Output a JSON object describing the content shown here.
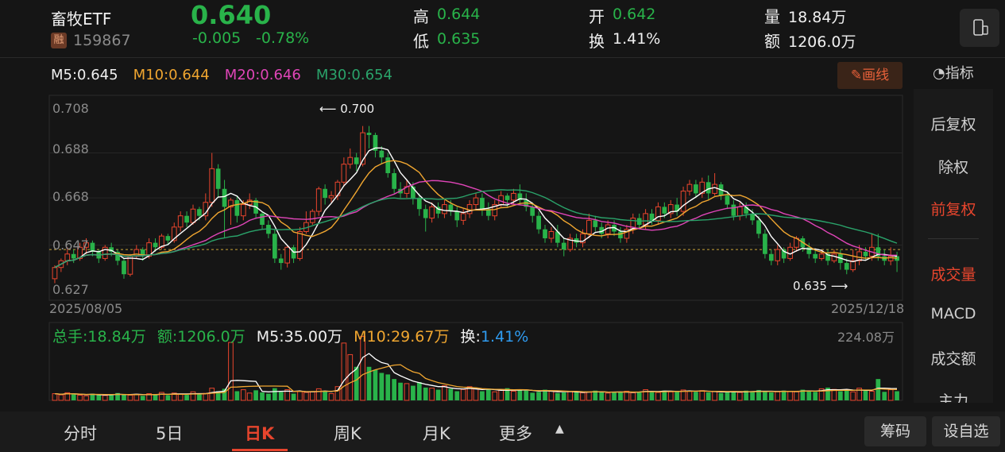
{
  "header": {
    "name": "畜牧ETF",
    "margin_badge": "融",
    "code": "159867",
    "price": "0.640",
    "change": "-0.005",
    "change_pct": "-0.78%",
    "high_label": "高",
    "high_value": "0.644",
    "low_label": "低",
    "low_value": "0.635",
    "open_label": "开",
    "open_value": "0.642",
    "turnover_label": "换",
    "turnover_value": "1.41%",
    "volume_label": "量",
    "volume_value": "18.84万",
    "amount_label": "额",
    "amount_value": "1206.0万"
  },
  "ma_legend": {
    "m5": "M5:0.645",
    "m10": "M10:0.644",
    "m20": "M20:0.646",
    "m30": "M30:0.654"
  },
  "draw_button": "画线",
  "indicator_label": "指标",
  "colors": {
    "up": "#e8452d",
    "down": "#29b34a",
    "ma5": "#ffffff",
    "ma10": "#f0a630",
    "ma20": "#e045b8",
    "ma30": "#2aa36a"
  },
  "chart_data": {
    "type": "candlestick",
    "y_ticks": [
      "0.708",
      "0.688",
      "0.668",
      "0.647",
      "0.627"
    ],
    "ylim": [
      0.627,
      0.708
    ],
    "x_start": "2025/08/05",
    "x_end": "2025/12/18",
    "annotation_high": "0.700",
    "annotation_low": "0.635",
    "reference_price": 0.645,
    "candles": [
      [
        0.632,
        0.637,
        0.63,
        0.638
      ],
      [
        0.637,
        0.64,
        0.635,
        0.641
      ],
      [
        0.64,
        0.643,
        0.638,
        0.646
      ],
      [
        0.643,
        0.641,
        0.639,
        0.645
      ],
      [
        0.641,
        0.646,
        0.64,
        0.648
      ],
      [
        0.646,
        0.648,
        0.643,
        0.65
      ],
      [
        0.648,
        0.644,
        0.642,
        0.649
      ],
      [
        0.644,
        0.641,
        0.639,
        0.645
      ],
      [
        0.641,
        0.646,
        0.64,
        0.647
      ],
      [
        0.646,
        0.644,
        0.642,
        0.648
      ],
      [
        0.644,
        0.64,
        0.638,
        0.645
      ],
      [
        0.64,
        0.634,
        0.632,
        0.641
      ],
      [
        0.634,
        0.642,
        0.633,
        0.643
      ],
      [
        0.642,
        0.645,
        0.641,
        0.647
      ],
      [
        0.645,
        0.642,
        0.64,
        0.646
      ],
      [
        0.642,
        0.648,
        0.641,
        0.65
      ],
      [
        0.648,
        0.646,
        0.644,
        0.65
      ],
      [
        0.646,
        0.651,
        0.645,
        0.652
      ],
      [
        0.651,
        0.649,
        0.647,
        0.652
      ],
      [
        0.649,
        0.655,
        0.648,
        0.657
      ],
      [
        0.655,
        0.66,
        0.653,
        0.662
      ],
      [
        0.66,
        0.657,
        0.655,
        0.662
      ],
      [
        0.657,
        0.663,
        0.656,
        0.665
      ],
      [
        0.663,
        0.66,
        0.658,
        0.664
      ],
      [
        0.66,
        0.666,
        0.658,
        0.67
      ],
      [
        0.666,
        0.681,
        0.664,
        0.688
      ],
      [
        0.681,
        0.672,
        0.668,
        0.683
      ],
      [
        0.672,
        0.664,
        0.65,
        0.676
      ],
      [
        0.664,
        0.667,
        0.656,
        0.668
      ],
      [
        0.667,
        0.66,
        0.657,
        0.669
      ],
      [
        0.66,
        0.665,
        0.658,
        0.667
      ],
      [
        0.665,
        0.667,
        0.663,
        0.67
      ],
      [
        0.667,
        0.661,
        0.659,
        0.668
      ],
      [
        0.661,
        0.656,
        0.654,
        0.662
      ],
      [
        0.656,
        0.652,
        0.65,
        0.658
      ],
      [
        0.652,
        0.641,
        0.639,
        0.654
      ],
      [
        0.641,
        0.639,
        0.636,
        0.643
      ],
      [
        0.639,
        0.646,
        0.637,
        0.647
      ],
      [
        0.646,
        0.641,
        0.639,
        0.647
      ],
      [
        0.641,
        0.653,
        0.64,
        0.655
      ],
      [
        0.653,
        0.657,
        0.652,
        0.662
      ],
      [
        0.657,
        0.662,
        0.656,
        0.663
      ],
      [
        0.662,
        0.672,
        0.66,
        0.673
      ],
      [
        0.672,
        0.668,
        0.665,
        0.674
      ],
      [
        0.668,
        0.669,
        0.666,
        0.671
      ],
      [
        0.669,
        0.675,
        0.667,
        0.676
      ],
      [
        0.675,
        0.683,
        0.673,
        0.686
      ],
      [
        0.683,
        0.686,
        0.681,
        0.69
      ],
      [
        0.686,
        0.683,
        0.68,
        0.688
      ],
      [
        0.683,
        0.697,
        0.682,
        0.7
      ],
      [
        0.697,
        0.696,
        0.69,
        0.7
      ],
      [
        0.696,
        0.689,
        0.686,
        0.697
      ],
      [
        0.689,
        0.686,
        0.683,
        0.691
      ],
      [
        0.686,
        0.679,
        0.677,
        0.688
      ],
      [
        0.679,
        0.672,
        0.67,
        0.681
      ],
      [
        0.672,
        0.67,
        0.668,
        0.675
      ],
      [
        0.67,
        0.673,
        0.668,
        0.676
      ],
      [
        0.673,
        0.668,
        0.665,
        0.675
      ],
      [
        0.668,
        0.663,
        0.66,
        0.67
      ],
      [
        0.663,
        0.659,
        0.653,
        0.665
      ],
      [
        0.659,
        0.664,
        0.657,
        0.666
      ],
      [
        0.664,
        0.661,
        0.659,
        0.666
      ],
      [
        0.661,
        0.665,
        0.659,
        0.667
      ],
      [
        0.665,
        0.662,
        0.66,
        0.667
      ],
      [
        0.662,
        0.658,
        0.655,
        0.664
      ],
      [
        0.658,
        0.661,
        0.656,
        0.663
      ],
      [
        0.661,
        0.665,
        0.659,
        0.667
      ],
      [
        0.665,
        0.668,
        0.663,
        0.67
      ],
      [
        0.668,
        0.663,
        0.66,
        0.67
      ],
      [
        0.663,
        0.66,
        0.658,
        0.666
      ],
      [
        0.66,
        0.665,
        0.658,
        0.667
      ],
      [
        0.665,
        0.669,
        0.664,
        0.671
      ],
      [
        0.669,
        0.667,
        0.664,
        0.67
      ],
      [
        0.667,
        0.67,
        0.665,
        0.672
      ],
      [
        0.67,
        0.667,
        0.665,
        0.674
      ],
      [
        0.667,
        0.664,
        0.662,
        0.67
      ],
      [
        0.664,
        0.66,
        0.657,
        0.666
      ],
      [
        0.66,
        0.654,
        0.652,
        0.662
      ],
      [
        0.654,
        0.65,
        0.648,
        0.656
      ],
      [
        0.65,
        0.653,
        0.648,
        0.655
      ],
      [
        0.653,
        0.648,
        0.646,
        0.656
      ],
      [
        0.648,
        0.645,
        0.642,
        0.65
      ],
      [
        0.645,
        0.65,
        0.644,
        0.652
      ],
      [
        0.65,
        0.648,
        0.646,
        0.652
      ],
      [
        0.648,
        0.652,
        0.646,
        0.654
      ],
      [
        0.652,
        0.658,
        0.65,
        0.661
      ],
      [
        0.658,
        0.655,
        0.653,
        0.66
      ],
      [
        0.655,
        0.652,
        0.65,
        0.657
      ],
      [
        0.652,
        0.656,
        0.65,
        0.658
      ],
      [
        0.656,
        0.653,
        0.651,
        0.658
      ],
      [
        0.653,
        0.65,
        0.648,
        0.655
      ],
      [
        0.65,
        0.654,
        0.648,
        0.656
      ],
      [
        0.654,
        0.659,
        0.652,
        0.661
      ],
      [
        0.659,
        0.656,
        0.654,
        0.661
      ],
      [
        0.656,
        0.661,
        0.654,
        0.663
      ],
      [
        0.661,
        0.658,
        0.656,
        0.663
      ],
      [
        0.658,
        0.664,
        0.656,
        0.666
      ],
      [
        0.664,
        0.661,
        0.659,
        0.666
      ],
      [
        0.661,
        0.665,
        0.659,
        0.667
      ],
      [
        0.665,
        0.662,
        0.66,
        0.668
      ],
      [
        0.662,
        0.671,
        0.66,
        0.673
      ],
      [
        0.671,
        0.674,
        0.669,
        0.676
      ],
      [
        0.674,
        0.67,
        0.668,
        0.676
      ],
      [
        0.67,
        0.675,
        0.668,
        0.677
      ],
      [
        0.675,
        0.67,
        0.667,
        0.678
      ],
      [
        0.67,
        0.674,
        0.669,
        0.679
      ],
      [
        0.674,
        0.669,
        0.667,
        0.675
      ],
      [
        0.669,
        0.665,
        0.663,
        0.671
      ],
      [
        0.665,
        0.66,
        0.658,
        0.667
      ],
      [
        0.66,
        0.664,
        0.658,
        0.666
      ],
      [
        0.664,
        0.661,
        0.659,
        0.666
      ],
      [
        0.661,
        0.658,
        0.656,
        0.663
      ],
      [
        0.658,
        0.652,
        0.65,
        0.66
      ],
      [
        0.652,
        0.643,
        0.641,
        0.654
      ],
      [
        0.643,
        0.64,
        0.638,
        0.645
      ],
      [
        0.64,
        0.645,
        0.638,
        0.647
      ],
      [
        0.645,
        0.641,
        0.639,
        0.646
      ],
      [
        0.641,
        0.646,
        0.64,
        0.648
      ],
      [
        0.646,
        0.65,
        0.644,
        0.651
      ],
      [
        0.65,
        0.646,
        0.644,
        0.651
      ],
      [
        0.646,
        0.643,
        0.641,
        0.648
      ],
      [
        0.643,
        0.641,
        0.639,
        0.645
      ],
      [
        0.641,
        0.643,
        0.64,
        0.645
      ],
      [
        0.643,
        0.64,
        0.638,
        0.645
      ],
      [
        0.64,
        0.643,
        0.639,
        0.645
      ],
      [
        0.643,
        0.639,
        0.636,
        0.645
      ],
      [
        0.639,
        0.636,
        0.634,
        0.641
      ],
      [
        0.636,
        0.64,
        0.635,
        0.645
      ],
      [
        0.64,
        0.644,
        0.638,
        0.647
      ],
      [
        0.644,
        0.642,
        0.64,
        0.646
      ],
      [
        0.642,
        0.646,
        0.64,
        0.652
      ],
      [
        0.646,
        0.642,
        0.64,
        0.652
      ],
      [
        0.642,
        0.64,
        0.638,
        0.645
      ],
      [
        0.64,
        0.642,
        0.638,
        0.646
      ],
      [
        0.642,
        0.64,
        0.635,
        0.644
      ]
    ],
    "volume": {
      "label_total": "总手:18.84万",
      "label_amount": "额:1206.0万",
      "label_m5": "M5:35.00万",
      "label_m10": "M10:29.67万",
      "label_turn_prefix": "换:",
      "label_turn_value": "1.41%",
      "max_label": "224.08万",
      "max_value": 224.08,
      "values": [
        22,
        18,
        25,
        20,
        17,
        15,
        22,
        18,
        16,
        20,
        24,
        19,
        17,
        20,
        15,
        22,
        18,
        26,
        17,
        24,
        21,
        18,
        28,
        20,
        23,
        40,
        30,
        38,
        190,
        30,
        35,
        24,
        33,
        26,
        22,
        40,
        28,
        35,
        22,
        30,
        26,
        28,
        38,
        30,
        22,
        45,
        188,
        150,
        110,
        210,
        110,
        100,
        90,
        85,
        70,
        58,
        55,
        48,
        60,
        42,
        40,
        35,
        48,
        38,
        30,
        36,
        45,
        38,
        30,
        35,
        28,
        34,
        40,
        30,
        36,
        32,
        25,
        28,
        35,
        30,
        24,
        26,
        30,
        28,
        25,
        27,
        32,
        28,
        24,
        26,
        28,
        30,
        25,
        28,
        35,
        30,
        26,
        32,
        28,
        30,
        34,
        30,
        28,
        32,
        26,
        30,
        24,
        28,
        30,
        26,
        32,
        28,
        34,
        30,
        26,
        28,
        32,
        30,
        28,
        35,
        30,
        28,
        38,
        42,
        36,
        30,
        34,
        28,
        40,
        32,
        30,
        70,
        28,
        35,
        30,
        26,
        24,
        22,
        30,
        28,
        35,
        30,
        28,
        40,
        30,
        22,
        45,
        30,
        34,
        28,
        26,
        50,
        30,
        26,
        20,
        75,
        30,
        28,
        32,
        22,
        20
      ]
    }
  },
  "side_panel": {
    "items": [
      "后复权",
      "除权",
      "前复权",
      "成交量",
      "MACD",
      "成交额",
      "主力"
    ]
  },
  "bottom_tabs": [
    "分时",
    "5日",
    "日K",
    "周K",
    "月K",
    "更多"
  ],
  "bottom_buttons": {
    "chips": "筹码",
    "add_watch": "设自选"
  }
}
